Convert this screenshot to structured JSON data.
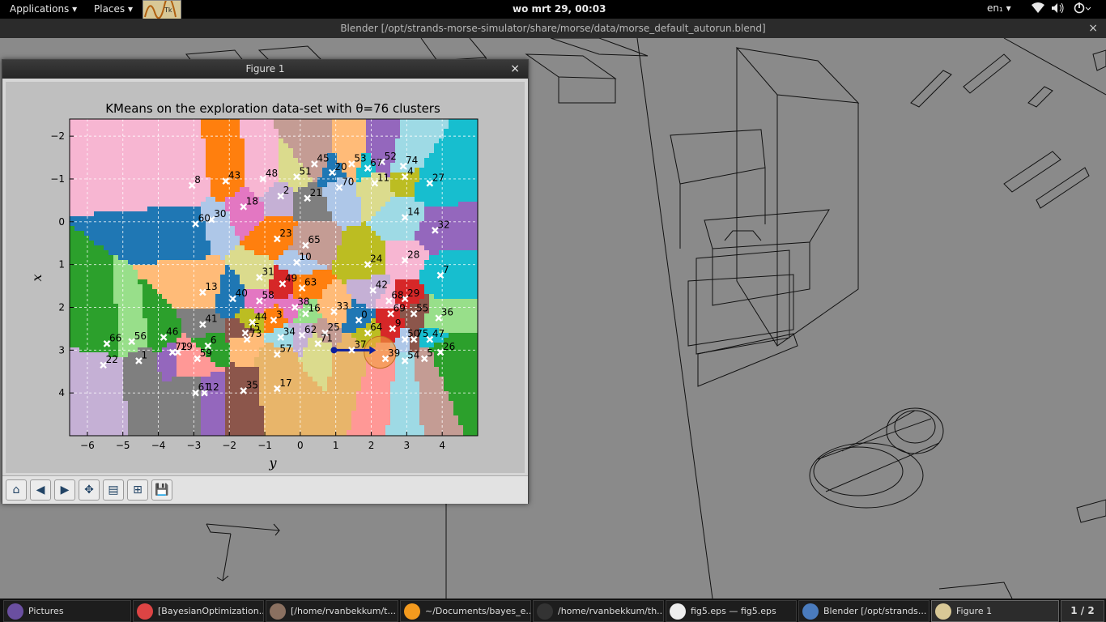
{
  "topbar": {
    "applications": "Applications ▾",
    "places": "Places ▾",
    "tk_label": "Tk",
    "clock": "wo mrt 29, 00:03",
    "lang": "en₁ ▾",
    "wifi_icon": "wifi-icon",
    "volume_icon": "volume-icon",
    "power_icon": "power-icon"
  },
  "blender": {
    "title": "Blender [/opt/strands-morse-simulator/share/morse/data/morse_default_autorun.blend]",
    "close": "×"
  },
  "figure": {
    "window_title": "Figure 1",
    "close": "×",
    "toolbar": {
      "home": "⌂",
      "back": "◀",
      "forward": "▶",
      "pan": "✥",
      "zoom": "▤",
      "subplots": "⊞",
      "save": "💾"
    }
  },
  "chart_data": {
    "type": "scatter",
    "title": "KMeans on the exploration data-set with θ=76 clusters",
    "xlabel": "y",
    "ylabel": "x",
    "xlim": [
      -6.5,
      5
    ],
    "ylim": [
      -2.4,
      5
    ],
    "y_inverted": true,
    "grid": true,
    "xticks": [
      -6,
      -5,
      -4,
      -3,
      -2,
      -1,
      0,
      1,
      2,
      3,
      4
    ],
    "yticks": [
      -2,
      -1,
      0,
      1,
      2,
      3,
      4
    ],
    "centroids": [
      {
        "id": "0",
        "x": 1.65,
        "y": 2.3
      },
      {
        "id": "1",
        "x": -4.55,
        "y": 3.25
      },
      {
        "id": "2",
        "x": -0.55,
        "y": -0.6
      },
      {
        "id": "3",
        "x": -0.75,
        "y": 2.3
      },
      {
        "id": "4",
        "x": 2.95,
        "y": -1.05
      },
      {
        "id": "5",
        "x": 3.5,
        "y": 3.2
      },
      {
        "id": "6",
        "x": -2.6,
        "y": 2.9
      },
      {
        "id": "7",
        "x": 3.95,
        "y": 1.25
      },
      {
        "id": "8",
        "x": -3.05,
        "y": -0.85
      },
      {
        "id": "9",
        "x": 2.6,
        "y": 2.5
      },
      {
        "id": "10",
        "x": -0.1,
        "y": 0.95
      },
      {
        "id": "11",
        "x": 2.1,
        "y": -0.9
      },
      {
        "id": "12",
        "x": -2.7,
        "y": 4.0
      },
      {
        "id": "13",
        "x": -2.75,
        "y": 1.65
      },
      {
        "id": "14",
        "x": 2.95,
        "y": -0.1
      },
      {
        "id": "15",
        "x": -1.55,
        "y": 2.6
      },
      {
        "id": "16",
        "x": 0.15,
        "y": 2.15
      },
      {
        "id": "17",
        "x": -0.65,
        "y": 3.9
      },
      {
        "id": "18",
        "x": -1.6,
        "y": -0.35
      },
      {
        "id": "19",
        "x": -3.45,
        "y": 3.05
      },
      {
        "id": "20",
        "x": 0.9,
        "y": -1.15
      },
      {
        "id": "21",
        "x": 0.2,
        "y": -0.55
      },
      {
        "id": "22",
        "x": -5.55,
        "y": 3.35
      },
      {
        "id": "23",
        "x": -0.65,
        "y": 0.4
      },
      {
        "id": "24",
        "x": 1.9,
        "y": 1.0
      },
      {
        "id": "25",
        "x": 0.7,
        "y": 2.6
      },
      {
        "id": "26",
        "x": 3.95,
        "y": 3.05
      },
      {
        "id": "27",
        "x": 3.65,
        "y": -0.9
      },
      {
        "id": "28",
        "x": 2.95,
        "y": 0.9
      },
      {
        "id": "29",
        "x": 2.95,
        "y": 1.8
      },
      {
        "id": "30",
        "x": -2.5,
        "y": -0.05
      },
      {
        "id": "31",
        "x": -1.15,
        "y": 1.3
      },
      {
        "id": "32",
        "x": 3.8,
        "y": 0.2
      },
      {
        "id": "33",
        "x": 0.95,
        "y": 2.1
      },
      {
        "id": "34",
        "x": -0.55,
        "y": 2.7
      },
      {
        "id": "35",
        "x": -1.6,
        "y": 3.95
      },
      {
        "id": "36",
        "x": 3.9,
        "y": 2.25
      },
      {
        "id": "37",
        "x": 1.45,
        "y": 3.0
      },
      {
        "id": "38",
        "x": -0.15,
        "y": 2.0
      },
      {
        "id": "39",
        "x": 2.4,
        "y": 3.2
      },
      {
        "id": "40",
        "x": -1.9,
        "y": 1.8
      },
      {
        "id": "41",
        "x": -2.75,
        "y": 2.4
      },
      {
        "id": "42",
        "x": 2.05,
        "y": 1.6
      },
      {
        "id": "43",
        "x": -2.1,
        "y": -0.95
      },
      {
        "id": "44",
        "x": -1.35,
        "y": 2.35
      },
      {
        "id": "45",
        "x": 0.4,
        "y": -1.35
      },
      {
        "id": "46",
        "x": -3.85,
        "y": 2.7
      },
      {
        "id": "47",
        "x": 3.65,
        "y": 2.75
      },
      {
        "id": "48",
        "x": -1.05,
        "y": -1.0
      },
      {
        "id": "49",
        "x": -0.5,
        "y": 1.45
      },
      {
        "id": "50",
        "x": 2.95,
        "y": 2.75
      },
      {
        "id": "51",
        "x": -0.1,
        "y": -1.05
      },
      {
        "id": "52",
        "x": 2.3,
        "y": -1.4
      },
      {
        "id": "53",
        "x": 1.45,
        "y": -1.35
      },
      {
        "id": "54",
        "x": 2.95,
        "y": 3.25
      },
      {
        "id": "55",
        "x": 3.2,
        "y": 2.15
      },
      {
        "id": "56",
        "x": -4.75,
        "y": 2.8
      },
      {
        "id": "57",
        "x": -0.65,
        "y": 3.1
      },
      {
        "id": "58",
        "x": -1.15,
        "y": 1.85
      },
      {
        "id": "59",
        "x": -2.9,
        "y": 3.2
      },
      {
        "id": "60",
        "x": -2.95,
        "y": 0.05
      },
      {
        "id": "61",
        "x": -2.95,
        "y": 4.0
      },
      {
        "id": "62",
        "x": 0.05,
        "y": 2.65
      },
      {
        "id": "63",
        "x": 0.05,
        "y": 1.55
      },
      {
        "id": "64",
        "x": 1.9,
        "y": 2.6
      },
      {
        "id": "65",
        "x": 0.15,
        "y": 0.55
      },
      {
        "id": "66",
        "x": -5.45,
        "y": 2.85
      },
      {
        "id": "67",
        "x": 1.9,
        "y": -1.25
      },
      {
        "id": "68",
        "x": 2.5,
        "y": 1.85
      },
      {
        "id": "69",
        "x": 2.55,
        "y": 2.15
      },
      {
        "id": "70",
        "x": 1.1,
        "y": -0.8
      },
      {
        "id": "71",
        "x": 0.5,
        "y": 2.85
      },
      {
        "id": "72",
        "x": -3.6,
        "y": 3.05
      },
      {
        "id": "73",
        "x": -1.5,
        "y": 2.75
      },
      {
        "id": "74",
        "x": 2.9,
        "y": -1.3
      },
      {
        "id": "75",
        "x": 3.2,
        "y": 2.75
      }
    ],
    "robot": {
      "x": 0.95,
      "y": 3.0,
      "heading_dx": 1.0,
      "heading_dy": 0.0
    },
    "uncertainty_circle": {
      "x": 2.25,
      "y": 3.05,
      "r": 0.45
    }
  },
  "taskbar": {
    "items": [
      {
        "label": "Pictures",
        "color": "#6a4fa0"
      },
      {
        "label": "[BayesianOptimization...",
        "color": "#d44"
      },
      {
        "label": "[/home/rvanbekkum/t...",
        "color": "#8a7060"
      },
      {
        "label": "~/Documents/bayes_e...",
        "color": "#f39a1e"
      },
      {
        "label": "/home/rvanbekkum/th...",
        "color": "#333"
      },
      {
        "label": "fig5.eps — fig5.eps",
        "color": "#eee"
      },
      {
        "label": "Blender [/opt/strands...",
        "color": "#4a7bbd"
      },
      {
        "label": "Figure 1",
        "color": "#d8c896"
      }
    ],
    "pager": "1 / 2"
  }
}
